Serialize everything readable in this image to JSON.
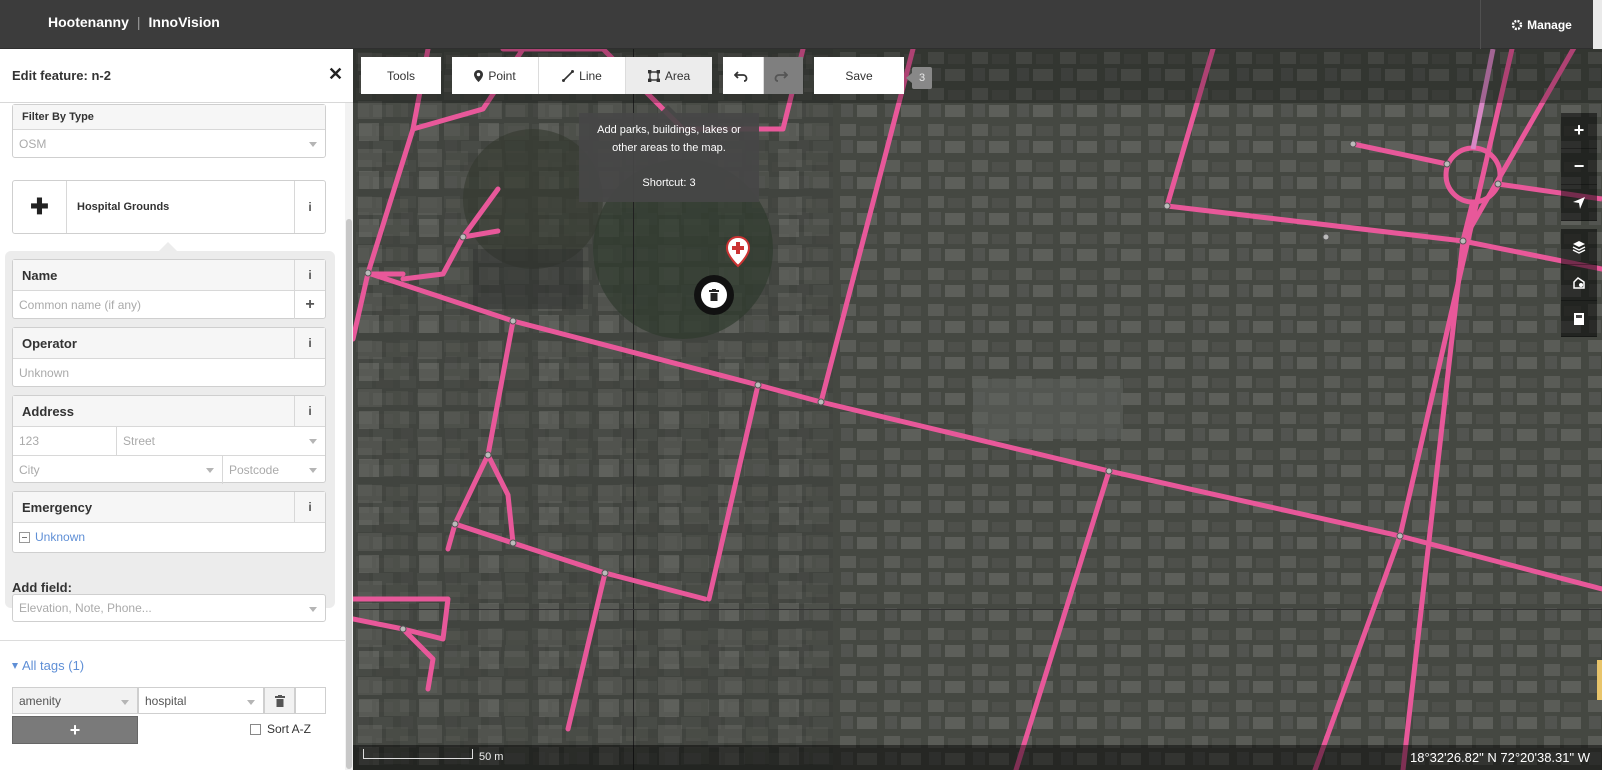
{
  "header": {
    "brand_primary": "Hootenanny",
    "brand_separator": "|",
    "brand_secondary": "InnoVision",
    "manage_label": "Manage",
    "manage_icon": "gear-icon"
  },
  "sidebar": {
    "title": "Edit feature: n-2",
    "close_glyph": "✕",
    "filter_by_type": {
      "label": "Filter By Type",
      "value": "OSM"
    },
    "preset": {
      "icon": "plus-icon",
      "icon_glyph": "✚",
      "name": "Hospital Grounds",
      "info_glyph": "i"
    },
    "fields": {
      "name": {
        "label": "Name",
        "placeholder": "Common name (if any)",
        "add_glyph": "+"
      },
      "operator": {
        "label": "Operator",
        "placeholder": "Unknown"
      },
      "address": {
        "label": "Address",
        "housenumber_placeholder": "123",
        "street_placeholder": "Street",
        "city_placeholder": "City",
        "postcode_placeholder": "Postcode"
      },
      "emergency": {
        "label": "Emergency",
        "value": "Unknown"
      }
    },
    "add_field": {
      "label": "Add field:",
      "placeholder": "Elevation, Note, Phone..."
    },
    "all_tags": {
      "label": "All tags (1)"
    },
    "tags": [
      {
        "key": "amenity",
        "value": "hospital"
      }
    ],
    "tag_add_glyph": "+",
    "sort_label": "Sort A-Z",
    "info_glyph": "i"
  },
  "toolbar": {
    "tools_label": "Tools",
    "point_label": "Point",
    "line_label": "Line",
    "area_label": "Area",
    "save_label": "Save",
    "edit_count": "3"
  },
  "tooltip": {
    "text_line1": "Add parks, buildings, lakes or",
    "text_line2": "other areas to the map.",
    "shortcut": "Shortcut: 3"
  },
  "map_controls": {
    "zoom_in": "+",
    "zoom_out": "−",
    "icons": [
      "plus-icon",
      "minus-icon",
      "geolocate-icon",
      "layers-icon",
      "map-data-icon",
      "help-icon"
    ]
  },
  "footer": {
    "scale_label": "50 m",
    "coordinates": "18°32'26.82\" N 72°20'38.31\" W"
  },
  "colors": {
    "road": "#e8589a",
    "header_bg": "#3c3c3c",
    "link": "#5f8fd6"
  }
}
